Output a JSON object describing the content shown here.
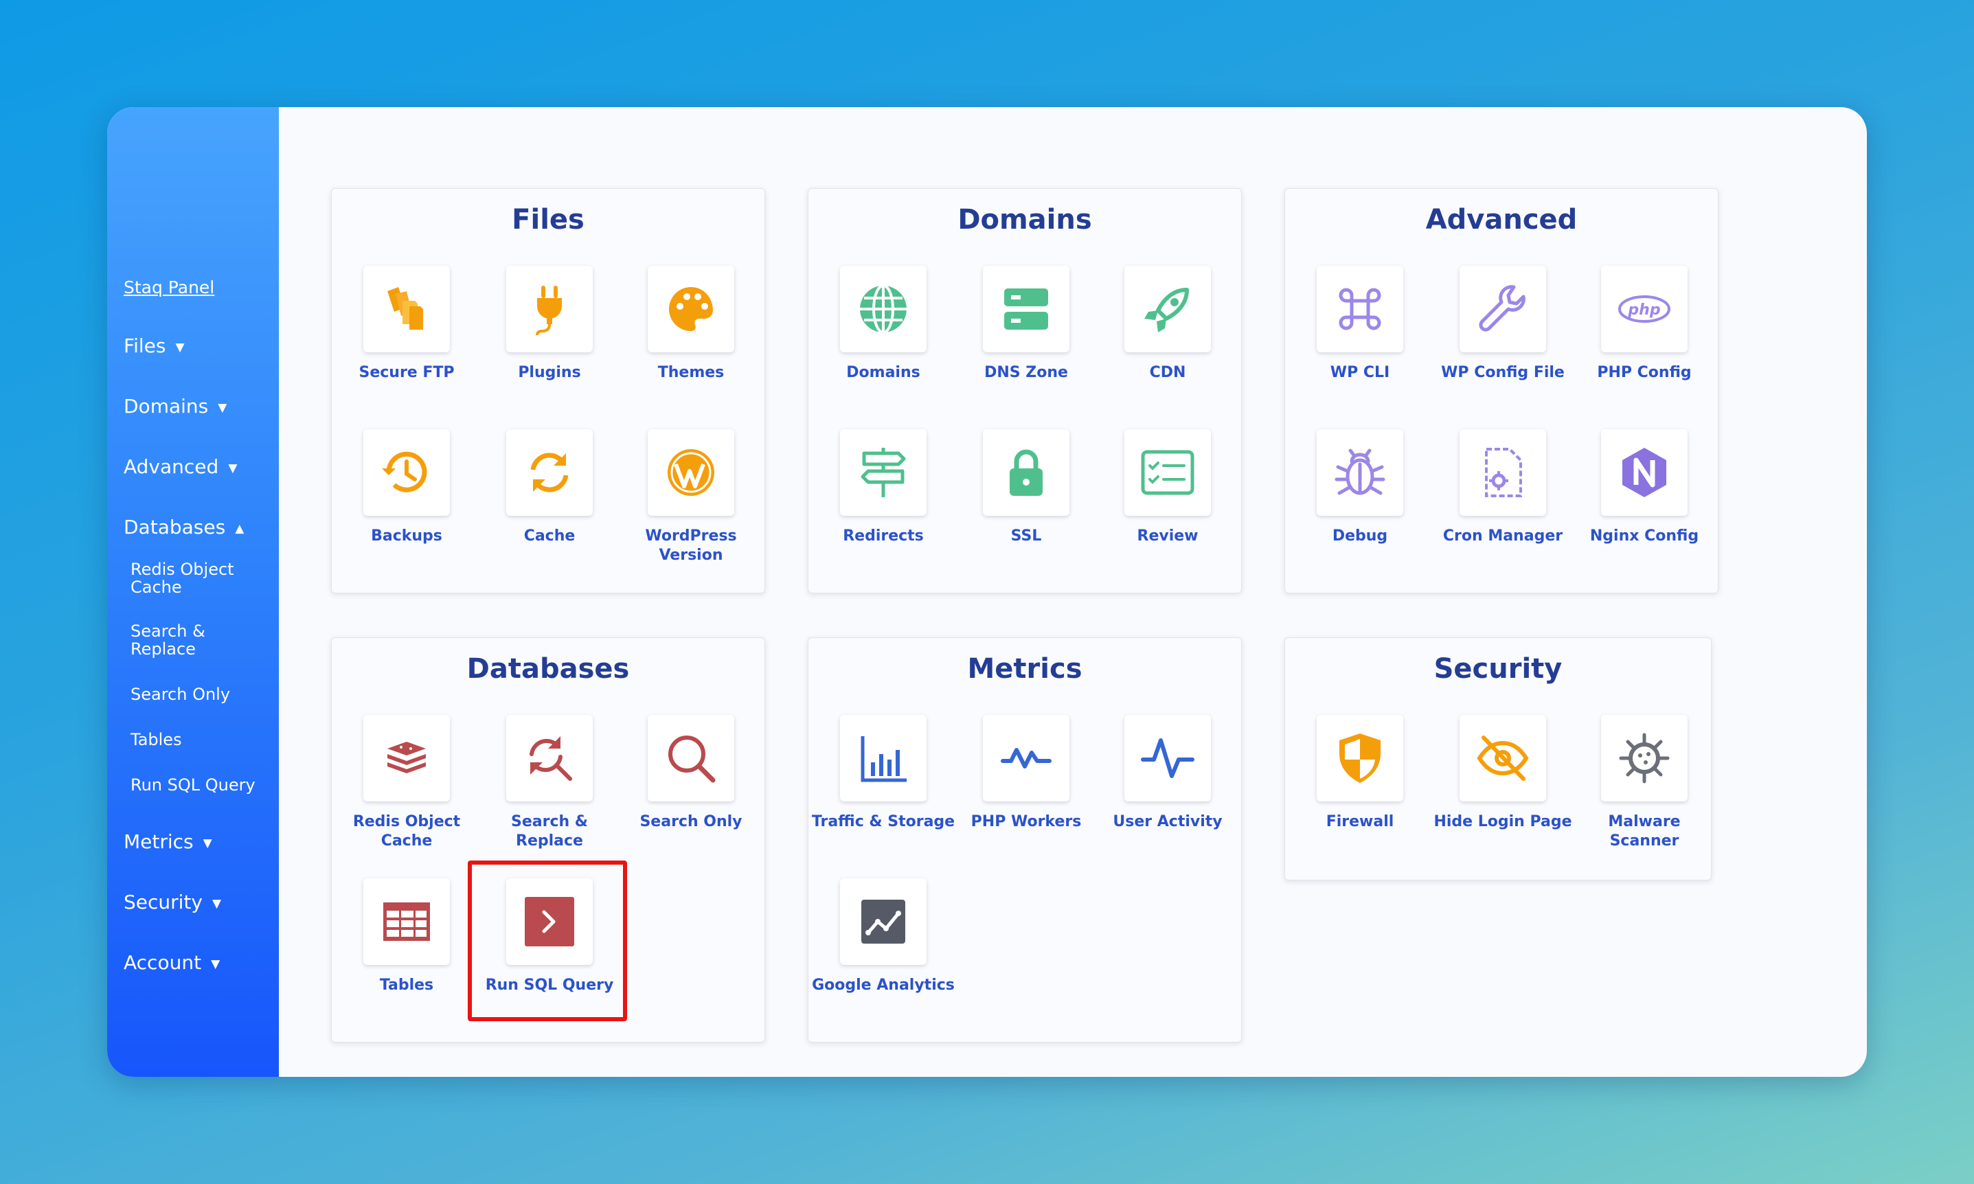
{
  "sidebar": {
    "panel_link": "Staq Panel",
    "nav": [
      {
        "label": "Files",
        "arrow": "▼"
      },
      {
        "label": "Domains",
        "arrow": "▼"
      },
      {
        "label": "Advanced",
        "arrow": "▼"
      },
      {
        "label": "Databases",
        "arrow": "▲",
        "children": [
          "Redis Object Cache",
          "Search & Replace",
          "Search Only",
          "Tables",
          "Run SQL Query"
        ]
      },
      {
        "label": "Metrics",
        "arrow": "▼"
      },
      {
        "label": "Security",
        "arrow": "▼"
      },
      {
        "label": "Account",
        "arrow": "▼"
      }
    ]
  },
  "sections": {
    "files": {
      "title": "Files",
      "tiles": [
        {
          "label": "Secure FTP",
          "icon": "files-icon",
          "color": "#f59e0b"
        },
        {
          "label": "Plugins",
          "icon": "plug-icon",
          "color": "#f59e0b"
        },
        {
          "label": "Themes",
          "icon": "palette-icon",
          "color": "#f59e0b"
        },
        {
          "label": "Backups",
          "icon": "history-icon",
          "color": "#f59e0b"
        },
        {
          "label": "Cache",
          "icon": "refresh-icon",
          "color": "#f59e0b"
        },
        {
          "label": "WordPress Version",
          "icon": "wordpress-icon",
          "color": "#f59e0b"
        }
      ]
    },
    "domains": {
      "title": "Domains",
      "tiles": [
        {
          "label": "Domains",
          "icon": "globe-icon",
          "color": "#4fc08d"
        },
        {
          "label": "DNS Zone",
          "icon": "server-icon",
          "color": "#4fc08d"
        },
        {
          "label": "CDN",
          "icon": "rocket-icon",
          "color": "#4fc08d"
        },
        {
          "label": "Redirects",
          "icon": "signpost-icon",
          "color": "#4fc08d"
        },
        {
          "label": "SSL",
          "icon": "lock-icon",
          "color": "#4fc08d"
        },
        {
          "label": "Review",
          "icon": "checklist-icon",
          "color": "#4fc08d"
        }
      ]
    },
    "advanced": {
      "title": "Advanced",
      "tiles": [
        {
          "label": "WP CLI",
          "icon": "command-icon",
          "color": "#9b87e8"
        },
        {
          "label": "WP Config File",
          "icon": "wrench-icon",
          "color": "#9b87e8"
        },
        {
          "label": "PHP Config",
          "icon": "php-icon",
          "color": "#9b87e8"
        },
        {
          "label": "Debug",
          "icon": "bug-icon",
          "color": "#9b87e8"
        },
        {
          "label": "Cron Manager",
          "icon": "file-gear-icon",
          "color": "#9b87e8"
        },
        {
          "label": "Nginx Config",
          "icon": "nginx-icon",
          "color": "#8a72e0"
        }
      ]
    },
    "databases": {
      "title": "Databases",
      "tiles": [
        {
          "label": "Redis Object Cache",
          "icon": "layers-icon",
          "color": "#b94a4e"
        },
        {
          "label": "Search & Replace",
          "icon": "search-refresh-icon",
          "color": "#b94a4e"
        },
        {
          "label": "Search Only",
          "icon": "search-icon",
          "color": "#b94a4e"
        },
        {
          "label": "Tables",
          "icon": "table-icon",
          "color": "#b94a4e"
        },
        {
          "label": "Run SQL Query",
          "icon": "terminal-icon",
          "color": "#b94a4e"
        }
      ]
    },
    "metrics": {
      "title": "Metrics",
      "tiles": [
        {
          "label": "Traffic & Storage",
          "icon": "bar-chart-icon",
          "color": "#3566d6"
        },
        {
          "label": "PHP Workers",
          "icon": "pulse-icon",
          "color": "#3566d6"
        },
        {
          "label": "User Activity",
          "icon": "activity-icon",
          "color": "#3566d6"
        },
        {
          "label": "Google Analytics",
          "icon": "analytics-icon",
          "color": "#555a66"
        }
      ]
    },
    "security": {
      "title": "Security",
      "tiles": [
        {
          "label": "Firewall",
          "icon": "shield-icon",
          "color": "#f59e0b"
        },
        {
          "label": "Hide Login Page",
          "icon": "eye-off-icon",
          "color": "#f59e0b"
        },
        {
          "label": "Malware Scanner",
          "icon": "virus-icon",
          "color": "#6b6f78"
        }
      ]
    }
  },
  "highlight_color": "#e81414"
}
